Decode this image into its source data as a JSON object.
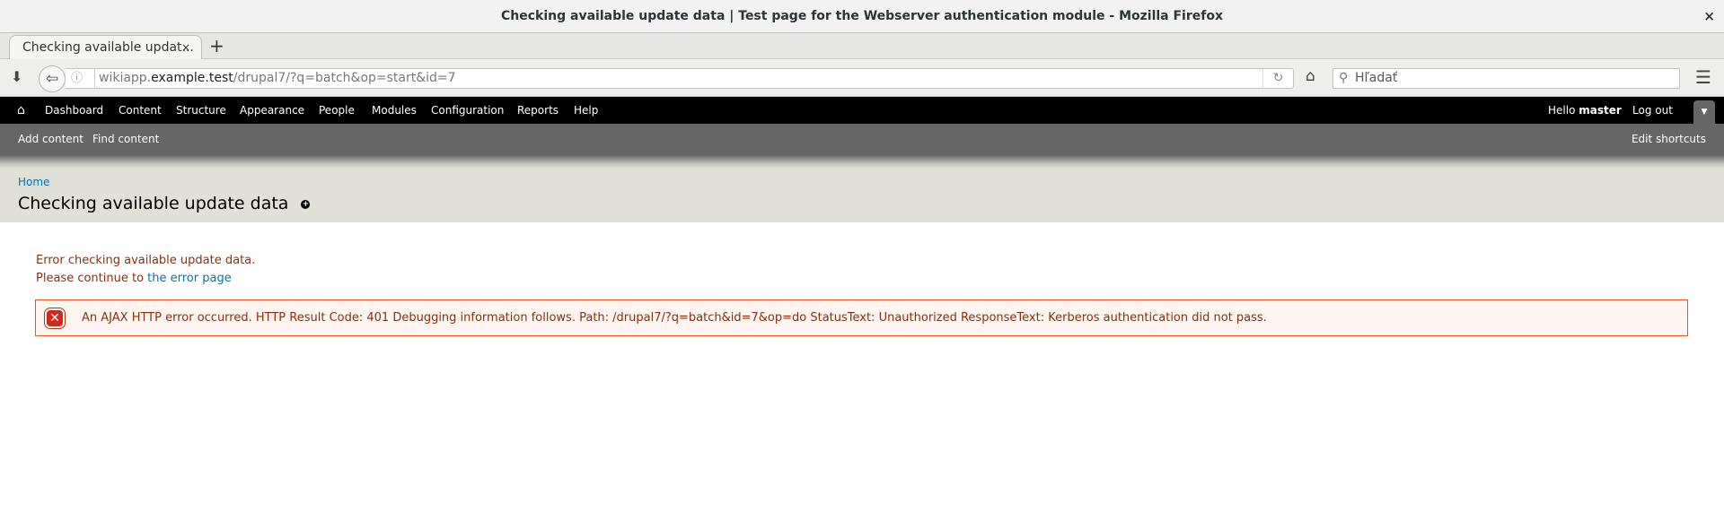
{
  "window": {
    "title": "Checking available update data | Test page for the Webserver authentication module - Mozilla Firefox",
    "close": "×"
  },
  "tab": {
    "label": "Checking available updat...",
    "close": "×",
    "new_tab": "+"
  },
  "nav": {
    "url_host_pre": "wikiapp.",
    "url_host": "example.test",
    "url_path": "/drupal7/?q=batch&op=start&id=7",
    "search_placeholder": "Hľadať"
  },
  "toolbar": {
    "items": [
      "Dashboard",
      "Content",
      "Structure",
      "Appearance",
      "People",
      "Modules",
      "Configuration",
      "Reports",
      "Help"
    ],
    "hello": "Hello ",
    "user": "master",
    "logout": "Log out"
  },
  "shortcuts": {
    "items": [
      "Add content",
      "Find content"
    ],
    "edit": "Edit shortcuts"
  },
  "header": {
    "breadcrumb": "Home",
    "title": "Checking available update data"
  },
  "main": {
    "line1": "Error checking available update data.",
    "line2_prefix": "Please continue to ",
    "line2_link": "the error page",
    "error": "An AJAX HTTP error occurred. HTTP Result Code: 401 Debugging information follows. Path: /drupal7/?q=batch&id=7&op=do StatusText: Unauthorized ResponseText: Kerberos authentication did not pass."
  }
}
